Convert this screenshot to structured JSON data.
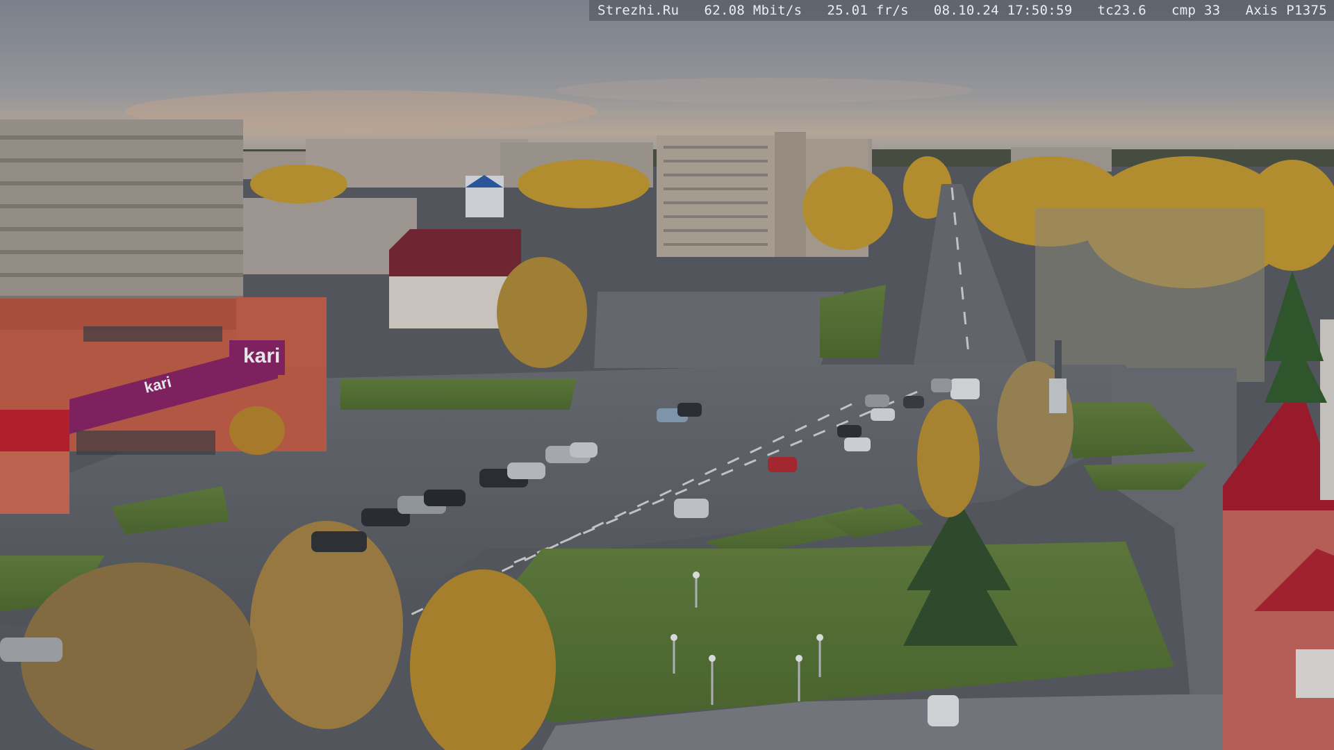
{
  "overlay": {
    "site": "Strezhi.Ru",
    "bitrate": "62.08 Mbit/s",
    "framerate": "25.01 fr/s",
    "datetime": "08.10.24 17:50:59",
    "tc": "tc23.6",
    "cmp": "cmp 33",
    "camera": "Axis P1375"
  },
  "signs": {
    "store_logo": "kari",
    "store_facade_logo": "kari"
  },
  "colors": {
    "sky_top": "#8d939c",
    "sky_horizon": "#c9b8a8",
    "asphalt": "#5d6066",
    "grass": "#5b7a34",
    "foliage_yellow": "#c69a2c",
    "store_red": "#c0463a",
    "kari_magenta": "#8a1f63"
  }
}
